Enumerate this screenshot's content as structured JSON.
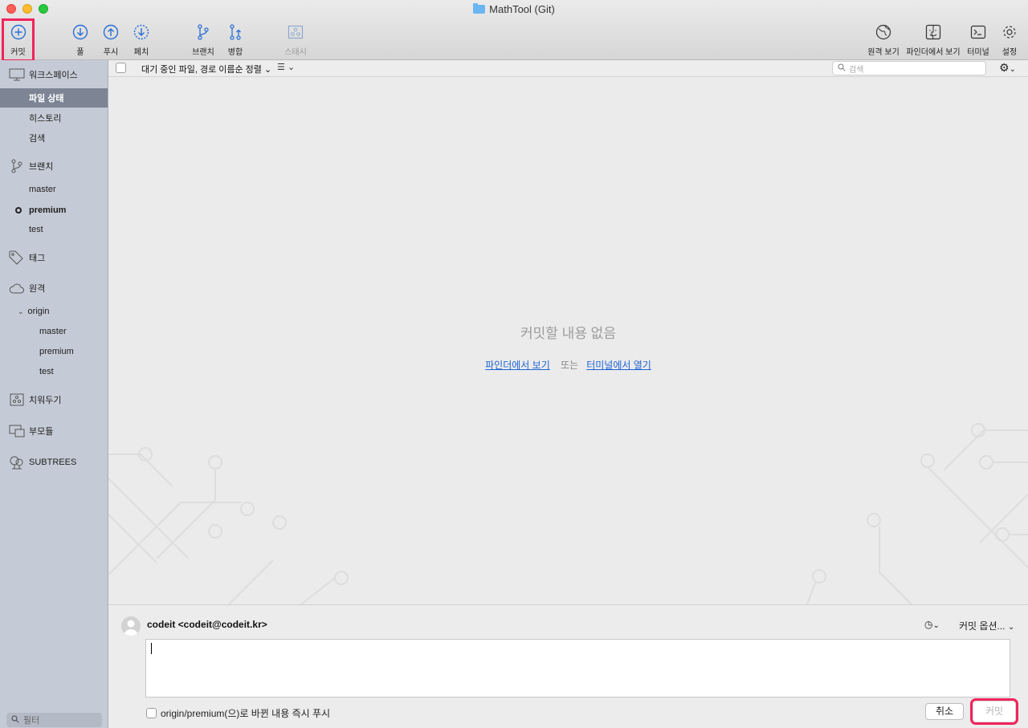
{
  "window": {
    "title": "MathTool (Git)"
  },
  "toolbar": {
    "commit": "커밋",
    "pull": "풀",
    "push": "푸시",
    "fetch": "페치",
    "branch": "브랜치",
    "merge": "병합",
    "stash": "스태시",
    "remote_view": "원격 보기",
    "finder_view": "파인더에서 보기",
    "terminal": "터미널",
    "settings": "설정"
  },
  "filterbar": {
    "sort_label": "대기 중인 파일, 경로 이름순 정렬",
    "search_placeholder": "검색"
  },
  "sidebar": {
    "workspace": "워크스페이스",
    "file_status": "파일 상태",
    "history": "히스토리",
    "search": "검색",
    "branches": "브랜치",
    "branch_items": [
      "master",
      "premium",
      "test"
    ],
    "current_branch": "premium",
    "tags": "태그",
    "remotes": "원격",
    "remote_origin": "origin",
    "remote_items": [
      "master",
      "premium",
      "test"
    ],
    "stashes": "치워두기",
    "submodules": "부모듈",
    "subtrees": "SUBTREES",
    "filter_placeholder": "필터"
  },
  "main": {
    "empty_text": "커밋할 내용 없음",
    "link_finder": "파인더에서 보기",
    "or_text": "또는",
    "link_terminal": "터미널에서 열기"
  },
  "commit_panel": {
    "author": "codeit <codeit@codeit.kr>",
    "options": "커밋 옵션...",
    "push_checkbox": "origin/premium(으)로 바뀐 내용 즉시 푸시",
    "cancel": "취소",
    "commit": "커밋",
    "message": ""
  },
  "colors": {
    "accent": "#1f63d6",
    "highlight": "#f0245c",
    "sidebar_bg": "#c5cbd6",
    "selected_bg": "#7d8595"
  }
}
